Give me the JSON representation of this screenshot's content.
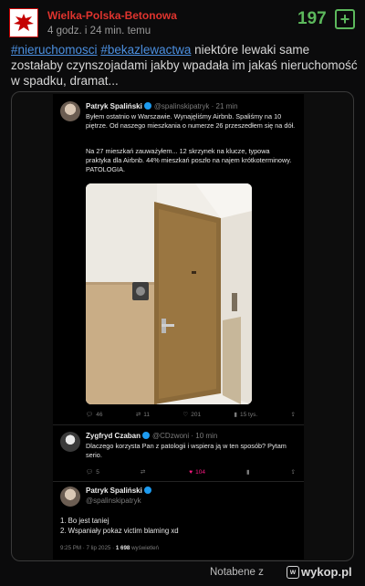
{
  "post": {
    "author": "Wielka-Polska-Betonowa",
    "time": "4 godz. i 24 min. temu",
    "score": "197",
    "plus_label": "+",
    "tags": [
      "#nieruchomosci",
      "#bekazlewactwa"
    ],
    "text": " niektóre lewaki same zostałaby czynszojadami jakby wpadała im jakaś nieruchomość w spadku, dramat..."
  },
  "tweet1": {
    "name": "Patryk Spaliński",
    "handle": "@spalinskipatryk · 21 min",
    "p1": "Byłem ostatnio w Warszawie. Wynajęliśmy Airbnb. Spaliśmy na 10 piętrze. Od naszego mieszkania o numerze 26 przeszedłem się na dół.",
    "p2": "Na 27 mieszkań zauważyłem... 12 skrzynek na klucze, typowa praktyka dla Airbnb. 44% mieszkań poszło na najem krótkoterminowy. PATOLOGIA.",
    "replies": "46",
    "retweets": "11",
    "likes": "201",
    "views": "15 tys."
  },
  "tweet2": {
    "name": "Zygfryd Czaban",
    "handle": "@CDzwoni · 10 min",
    "text": "Dlaczego korzysta Pan z patologii i wspiera ją w ten sposób? Pytam serio.",
    "replies": "5",
    "retweets": "",
    "likes": "104"
  },
  "tweet3": {
    "name": "Patryk Spaliński",
    "handle": "@spalinskipatryk",
    "line1": "1. Bo jest taniej",
    "line2": "2. Wspaniały pokaz victim blaming xd",
    "meta_time": "9:25 PM · 7 lip 2025 · ",
    "meta_views": "1 698",
    "meta_suffix": " wyświetleń"
  },
  "footer": {
    "user": "Notabene z",
    "logo": "wykop.pl"
  },
  "colors": {
    "author": "#e0342e",
    "score": "#5cb85c",
    "tag": "#4b8fe0",
    "like": "#f91880"
  }
}
